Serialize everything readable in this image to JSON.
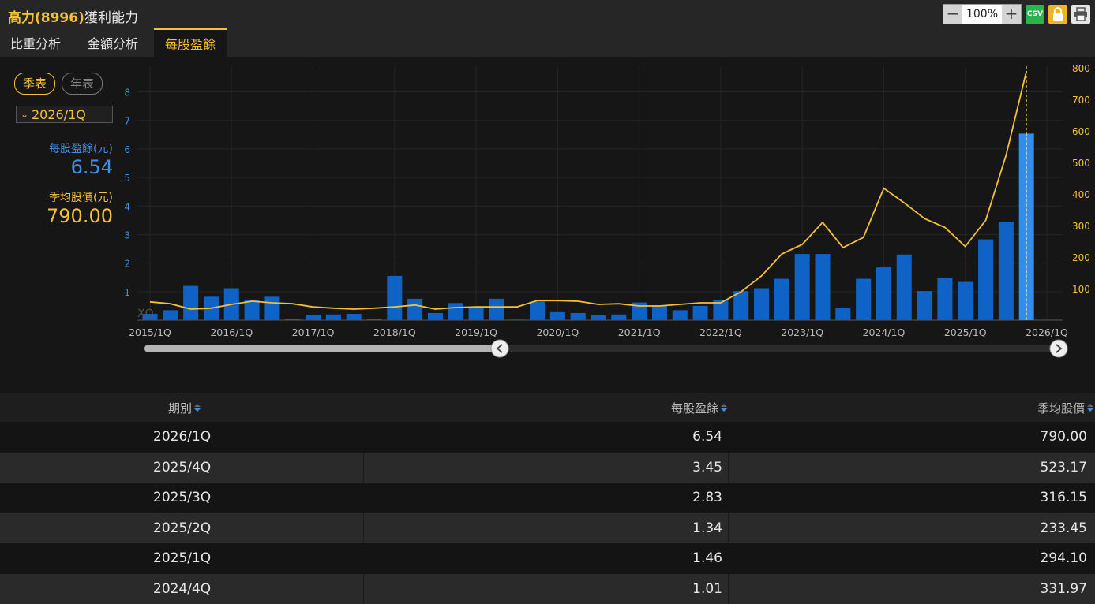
{
  "header": {
    "stock": "高力(8996)",
    "subtitle": "獲利能力",
    "zoom": "100%",
    "zoom_minus": "−",
    "zoom_plus": "+",
    "csv_label": "CSV"
  },
  "tabs": [
    {
      "label": "比重分析",
      "active": false
    },
    {
      "label": "金額分析",
      "active": false
    },
    {
      "label": "每股盈餘",
      "active": true
    }
  ],
  "filters": {
    "quarterly": "季表",
    "annual": "年表",
    "selected_period": "2026/1Q"
  },
  "summary": {
    "eps_label": "每股盈餘(元)",
    "eps_value": "6.54",
    "price_label": "季均股價(元)",
    "price_value": "790.00"
  },
  "colors": {
    "accent": "#f3c036",
    "eps_bar": "#0f63c7",
    "eps_text": "#3f8fe6",
    "price_line": "#f3c036"
  },
  "chart_data": {
    "type": "bar",
    "watermark": "XQ",
    "categories": [
      "2015/1Q",
      "2015/2Q",
      "2015/3Q",
      "2015/4Q",
      "2016/1Q",
      "2016/2Q",
      "2016/3Q",
      "2016/4Q",
      "2017/1Q",
      "2017/2Q",
      "2017/3Q",
      "2017/4Q",
      "2018/1Q",
      "2018/2Q",
      "2018/3Q",
      "2018/4Q",
      "2019/1Q",
      "2019/2Q",
      "2019/3Q",
      "2019/4Q",
      "2020/1Q",
      "2020/2Q",
      "2020/3Q",
      "2020/4Q",
      "2021/1Q",
      "2021/2Q",
      "2021/3Q",
      "2021/4Q",
      "2022/1Q",
      "2022/2Q",
      "2022/3Q",
      "2022/4Q",
      "2023/1Q",
      "2023/2Q",
      "2023/3Q",
      "2023/4Q",
      "2024/1Q",
      "2024/2Q",
      "2024/3Q",
      "2024/4Q",
      "2025/1Q",
      "2025/2Q",
      "2025/3Q",
      "2025/4Q",
      "2026/1Q"
    ],
    "x_tick_labels": [
      "2015/1Q",
      "2016/1Q",
      "2017/1Q",
      "2018/1Q",
      "2019/1Q",
      "2020/1Q",
      "2021/1Q",
      "2022/1Q",
      "2023/1Q",
      "2024/1Q",
      "2025/1Q",
      "2026/1Q"
    ],
    "series": [
      {
        "name": "每股盈餘(元)",
        "axis": "left",
        "kind": "bar",
        "values": [
          0.22,
          0.35,
          1.2,
          0.82,
          1.12,
          0.72,
          0.82,
          0.03,
          0.18,
          0.2,
          0.22,
          0.05,
          1.55,
          0.75,
          0.25,
          0.6,
          0.45,
          0.75,
          0.02,
          0.65,
          0.28,
          0.25,
          0.18,
          0.2,
          0.62,
          0.52,
          0.35,
          0.5,
          0.72,
          1.02,
          1.12,
          1.45,
          2.32,
          2.32,
          0.42,
          1.45,
          1.85,
          2.3,
          1.02,
          1.47,
          1.34,
          2.83,
          3.45,
          6.54
        ]
      },
      {
        "name": "季均股價(元)",
        "axis": "right",
        "kind": "line",
        "values": [
          58,
          52,
          35,
          38,
          50,
          60,
          55,
          52,
          42,
          38,
          35,
          38,
          42,
          48,
          35,
          40,
          42,
          42,
          42,
          62,
          62,
          60,
          50,
          52,
          45,
          45,
          50,
          55,
          55,
          90,
          140,
          210,
          240,
          310,
          230,
          262,
          418,
          372,
          322,
          294,
          233.45,
          316.15,
          523.17,
          790
        ]
      }
    ],
    "ylim_left": [
      0,
      8.9
    ],
    "yticks_left": [
      1,
      2,
      3,
      4,
      5,
      6,
      7,
      8
    ],
    "ylim_right": [
      0,
      805
    ],
    "yticks_right": [
      100,
      200,
      300,
      400,
      500,
      600,
      700,
      800
    ],
    "grid": true
  },
  "table": {
    "columns": [
      "期別",
      "每股盈餘",
      "季均股價"
    ],
    "rows": [
      {
        "period": "2026/1Q",
        "eps": "6.54",
        "price": "790.00"
      },
      {
        "period": "2025/4Q",
        "eps": "3.45",
        "price": "523.17"
      },
      {
        "period": "2025/3Q",
        "eps": "2.83",
        "price": "316.15"
      },
      {
        "period": "2025/2Q",
        "eps": "1.34",
        "price": "233.45"
      },
      {
        "period": "2025/1Q",
        "eps": "1.46",
        "price": "294.10"
      },
      {
        "period": "2024/4Q",
        "eps": "1.01",
        "price": "331.97"
      }
    ]
  }
}
